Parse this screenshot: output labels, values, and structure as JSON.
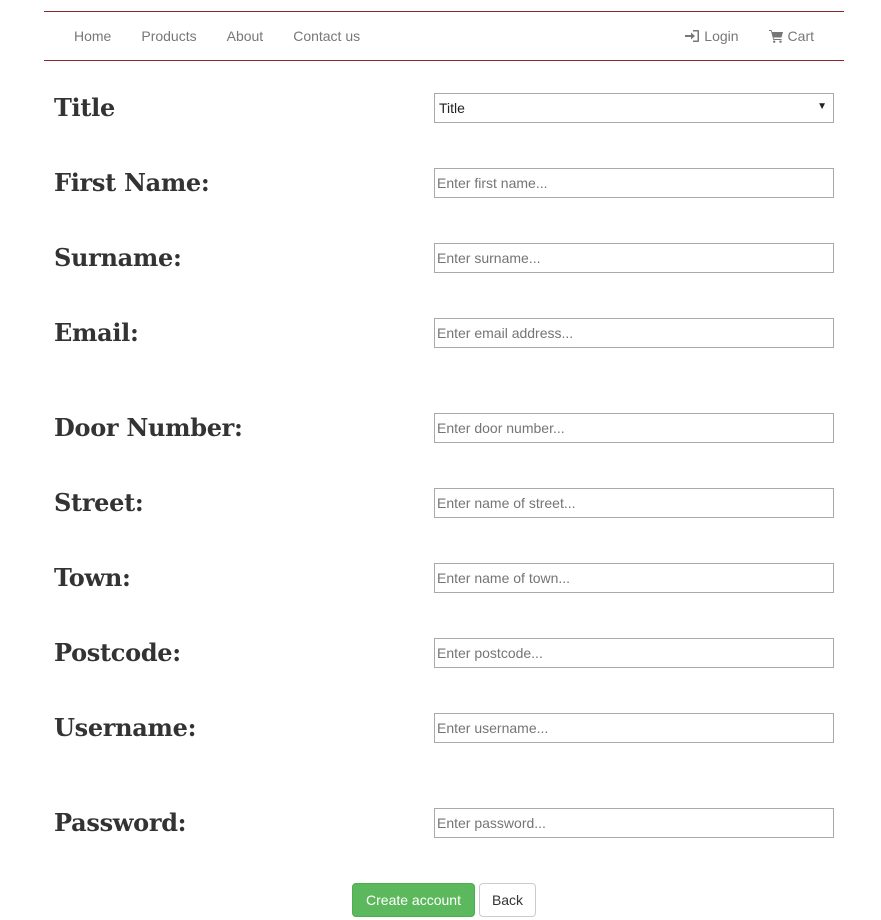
{
  "nav": {
    "left_items": [
      {
        "label": "Home"
      },
      {
        "label": "Products"
      },
      {
        "label": "About"
      },
      {
        "label": "Contact us"
      }
    ],
    "login_label": "Login",
    "cart_label": "Cart",
    "login_icon": "log-in-icon",
    "cart_icon": "shopping-cart-icon",
    "border_color": "#8b2a2a"
  },
  "form": {
    "title": {
      "label": "Title",
      "selected": "Title"
    },
    "first_name": {
      "label": "First Name:",
      "placeholder": "Enter first name..."
    },
    "surname": {
      "label": "Surname:",
      "placeholder": "Enter surname..."
    },
    "email": {
      "label": "Email:",
      "placeholder": "Enter email address..."
    },
    "door_number": {
      "label": "Door Number:",
      "placeholder": "Enter door number..."
    },
    "street": {
      "label": "Street:",
      "placeholder": "Enter name of street..."
    },
    "town": {
      "label": "Town:",
      "placeholder": "Enter name of town..."
    },
    "postcode": {
      "label": "Postcode:",
      "placeholder": "Enter postcode..."
    },
    "username": {
      "label": "Username:",
      "placeholder": "Enter username..."
    },
    "password": {
      "label": "Password:",
      "placeholder": "Enter password..."
    }
  },
  "buttons": {
    "create_label": "Create account",
    "back_label": "Back",
    "create_color": "#5cb85c"
  }
}
